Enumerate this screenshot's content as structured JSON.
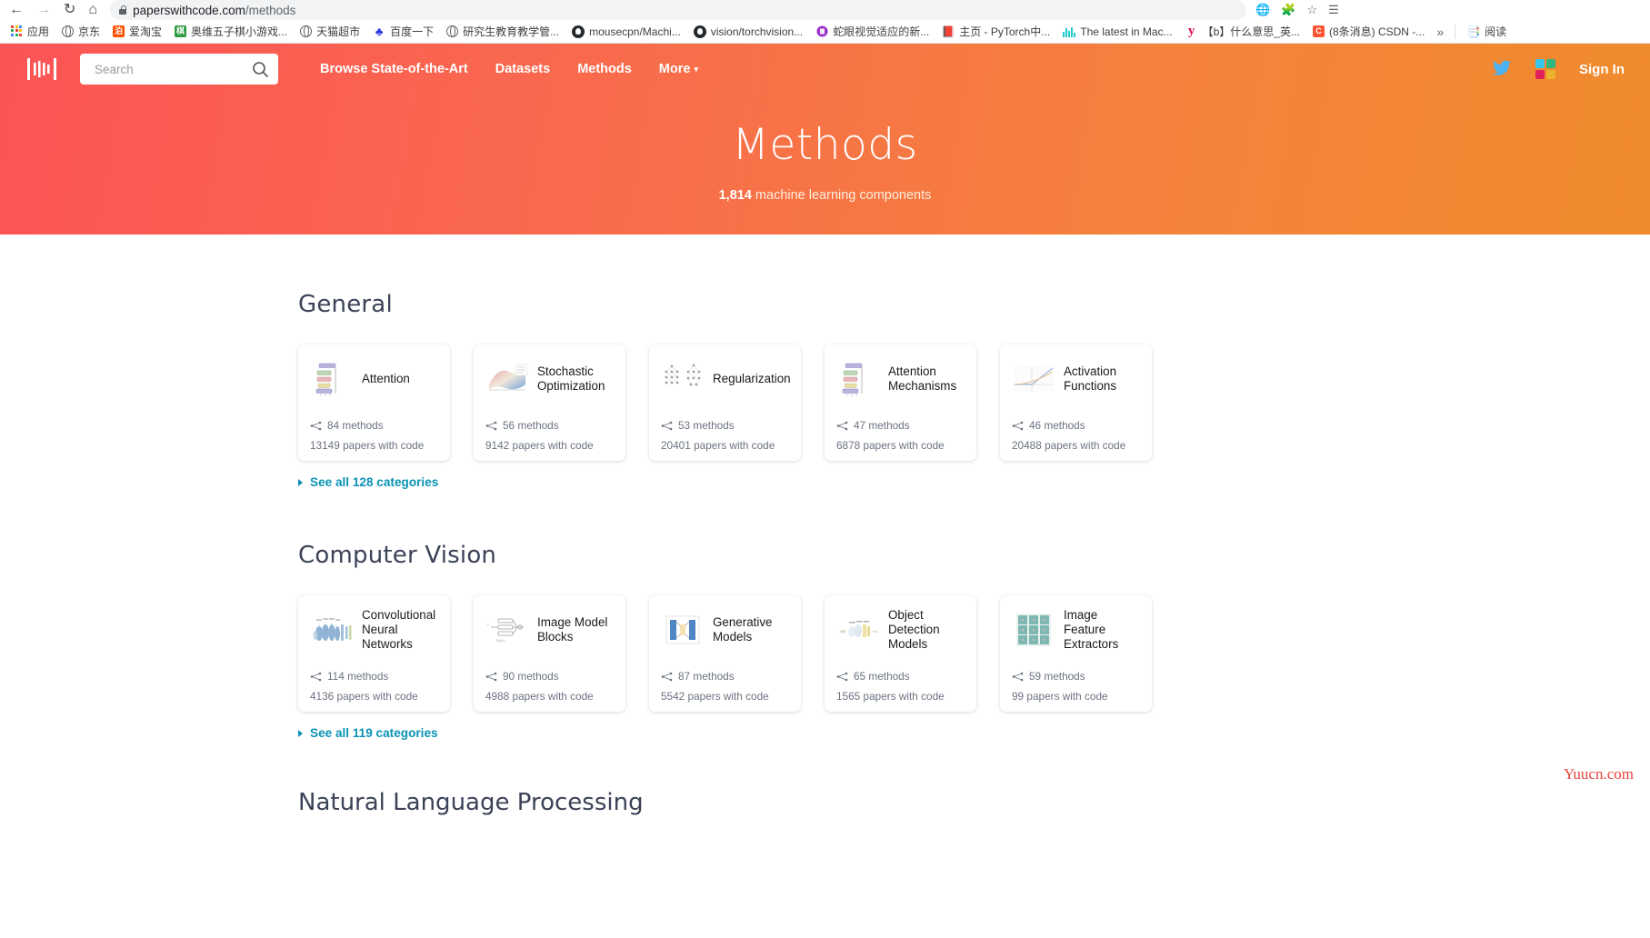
{
  "browser": {
    "nav": {
      "back": "←",
      "forward": "→",
      "reload": "↻",
      "home": "⌂"
    },
    "url_secure": "paperswithcode.com",
    "url_path": "/methods",
    "right_icons": [
      "translate-icon",
      "extension-icon",
      "star-icon",
      "profile-icon",
      "menu-icon"
    ],
    "bookmarks": [
      {
        "icon": "apps-grid-icon",
        "label": "应用",
        "color": "#4285f4"
      },
      {
        "icon": "globe-icon",
        "label": "京东",
        "color": "#5f6368"
      },
      {
        "icon": "taobao-icon",
        "label": "爱淘宝",
        "color": "#ff5000"
      },
      {
        "icon": "game-icon",
        "label": "奥维五子棋小游戏...",
        "color": "#2e9b3f"
      },
      {
        "icon": "globe-icon",
        "label": "天猫超市",
        "color": "#5f6368"
      },
      {
        "icon": "baidu-icon",
        "label": "百度一下",
        "color": "#2932e1"
      },
      {
        "icon": "globe-icon",
        "label": "研究生教育教学管...",
        "color": "#5f6368"
      },
      {
        "icon": "github-icon",
        "label": "mousecpn/Machi...",
        "color": "#24292e"
      },
      {
        "icon": "github-icon",
        "label": "vision/torchvision...",
        "color": "#24292e"
      },
      {
        "icon": "zhihu-icon",
        "label": "蛇眼视觉适应的新...",
        "color": "#9b30c9"
      },
      {
        "icon": "book-icon",
        "label": "主页 - PyTorch中...",
        "color": "#1a1a1a"
      },
      {
        "icon": "pwc-icon",
        "label": "The latest in Mac...",
        "color": "#21cbce"
      },
      {
        "icon": "yahoo-icon",
        "label": "【b】什么意思_英...",
        "color": "#e30b5d"
      },
      {
        "icon": "csdn-icon",
        "label": "(8条消息) CSDN -...",
        "color": "#fc5531"
      }
    ],
    "bookmarks_overflow": "»",
    "reader_label": "阅读"
  },
  "site": {
    "logo": "paperswithcode-logo",
    "search": {
      "placeholder": "Search",
      "value": "",
      "icon": "search-icon"
    },
    "nav": [
      {
        "label": "Browse State-of-the-Art",
        "has_caret": false
      },
      {
        "label": "Datasets",
        "has_caret": false
      },
      {
        "label": "Methods",
        "has_caret": false
      },
      {
        "label": "More",
        "has_caret": true
      }
    ],
    "twitter_icon": "twitter-icon",
    "slack_icon": "slack-icon",
    "sign_in": "Sign In",
    "hero_title": "Methods",
    "hero_count": "1,814",
    "hero_sub_rest": " machine learning components",
    "colors": {
      "hero_left": "#fb5456",
      "hero_right": "#ef8b2c",
      "link": "#0a93b5"
    }
  },
  "sections": [
    {
      "title": "General",
      "see_all": "See all 128 categories",
      "cards": [
        {
          "name": "Attention",
          "methods": "84 methods",
          "papers": "13149 papers with code",
          "thumb": "attention-diagram-thumb"
        },
        {
          "name": "Stochastic Optimization",
          "methods": "56 methods",
          "papers": "9142 papers with code",
          "thumb": "loss-surface-thumb"
        },
        {
          "name": "Regularization",
          "methods": "53 methods",
          "papers": "20401 papers with code",
          "thumb": "dropout-network-thumb"
        },
        {
          "name": "Attention Mechanisms",
          "methods": "47 methods",
          "papers": "6878 papers with code",
          "thumb": "attention-diagram-thumb"
        },
        {
          "name": "Activation Functions",
          "methods": "46 methods",
          "papers": "20488 papers with code",
          "thumb": "activation-curve-thumb"
        }
      ]
    },
    {
      "title": "Computer Vision",
      "see_all": "See all 119 categories",
      "cards": [
        {
          "name": "Convolutional Neural Networks",
          "methods": "114 methods",
          "papers": "4136 papers with code",
          "thumb": "cnn-layers-thumb"
        },
        {
          "name": "Image Model Blocks",
          "methods": "90 methods",
          "papers": "4988 papers with code",
          "thumb": "block-diagram-thumb"
        },
        {
          "name": "Generative Models",
          "methods": "87 methods",
          "papers": "5542 papers with code",
          "thumb": "autoencoder-thumb"
        },
        {
          "name": "Object Detection Models",
          "methods": "65 methods",
          "papers": "1565 papers with code",
          "thumb": "detection-net-thumb"
        },
        {
          "name": "Image Feature Extractors",
          "methods": "59 methods",
          "papers": "99 papers with code",
          "thumb": "feature-grid-thumb"
        }
      ]
    }
  ],
  "next_section_title": "Natural Language Processing",
  "watermark": "Yuucn.com"
}
